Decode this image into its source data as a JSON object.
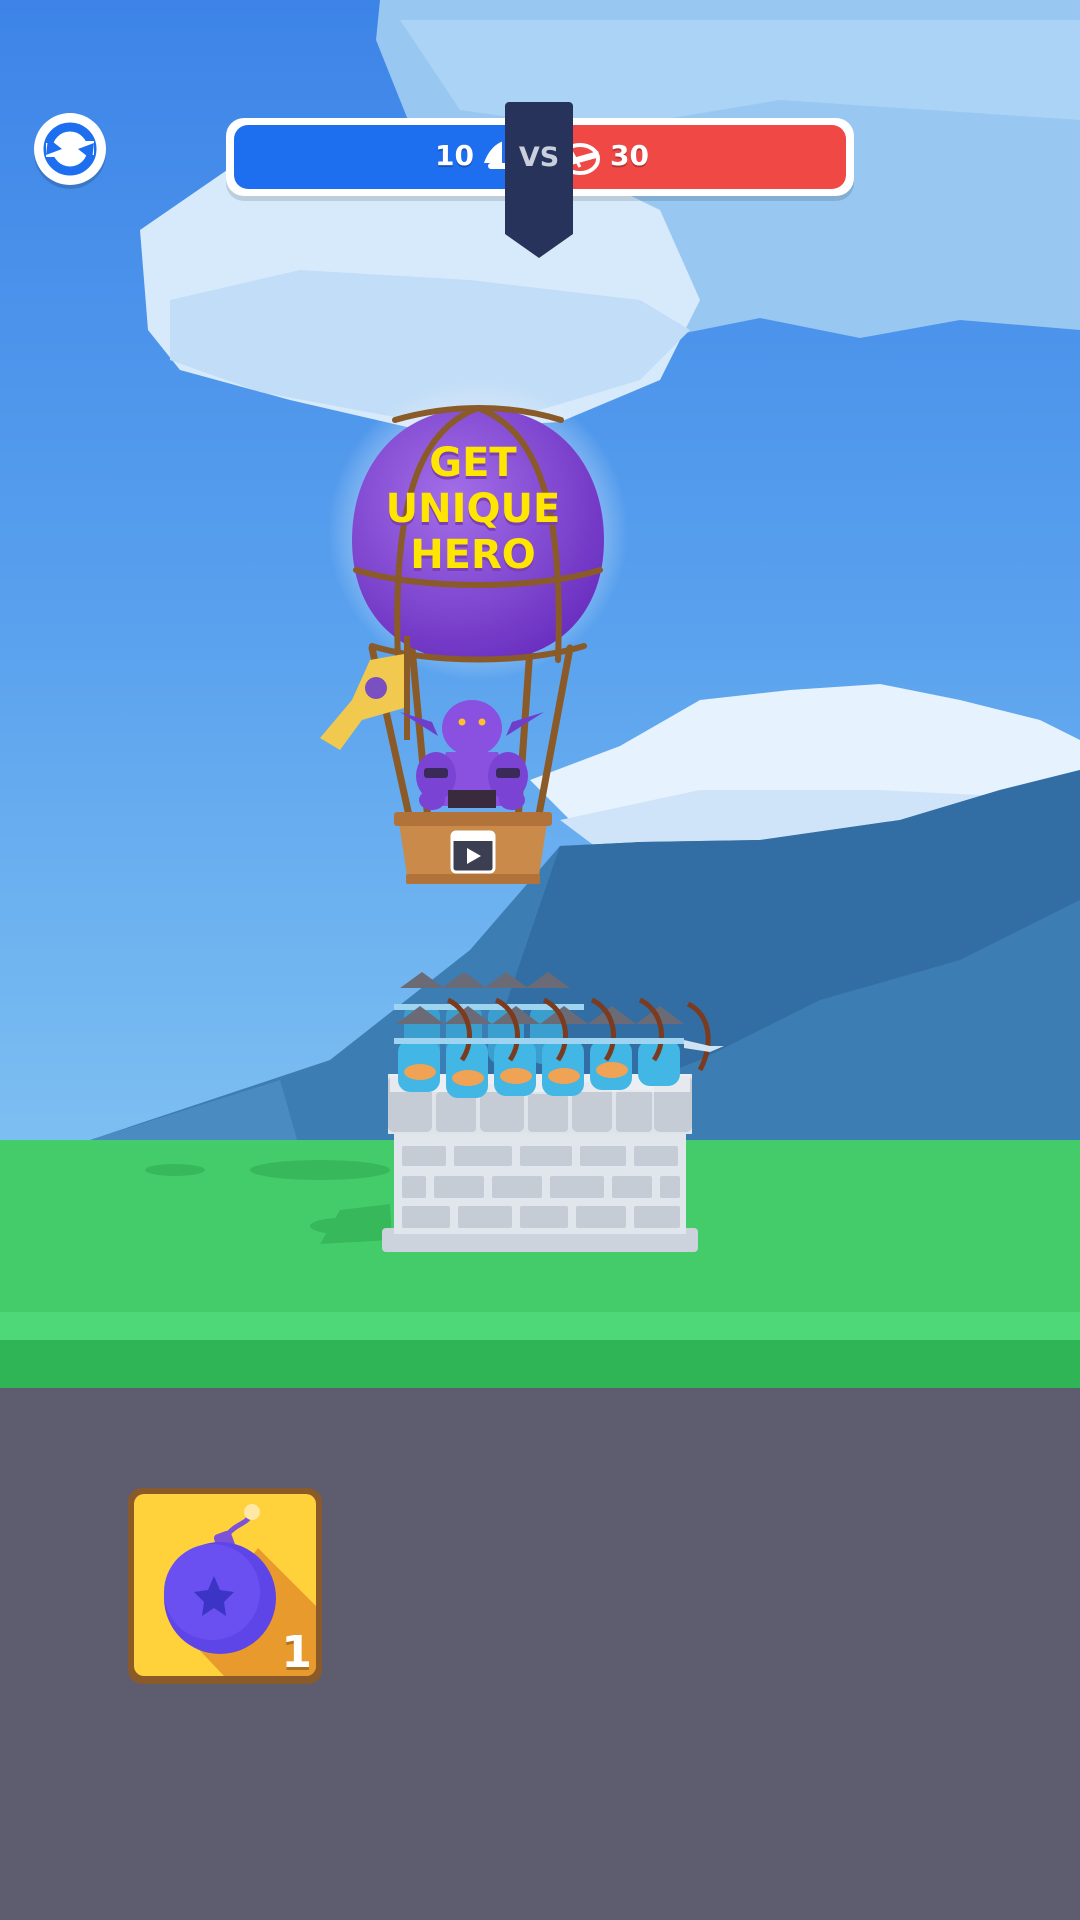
{
  "hud": {
    "restart_icon": "restart-icon",
    "score": {
      "blue_count": "10",
      "blue_icon": "blue-helmet-icon",
      "vs_label": "VS",
      "red_count": "30",
      "red_icon": "red-helmet-icon",
      "blue_color": "#1e6ff0",
      "red_color": "#f04845"
    }
  },
  "offer": {
    "balloon_lines": [
      "GET",
      "UNIQUE",
      "HERO"
    ],
    "balloon_color": "#8a4fd8",
    "text_color": "#ffe600",
    "ad_icon": "video-ad-icon"
  },
  "scene": {
    "sky_color": "#4f90e6",
    "grass_color": "#45cc6a",
    "panel_color": "#5e5c6f"
  },
  "inventory": {
    "items": [
      {
        "name": "bomb",
        "icon": "bomb-icon",
        "count": "1"
      }
    ]
  }
}
